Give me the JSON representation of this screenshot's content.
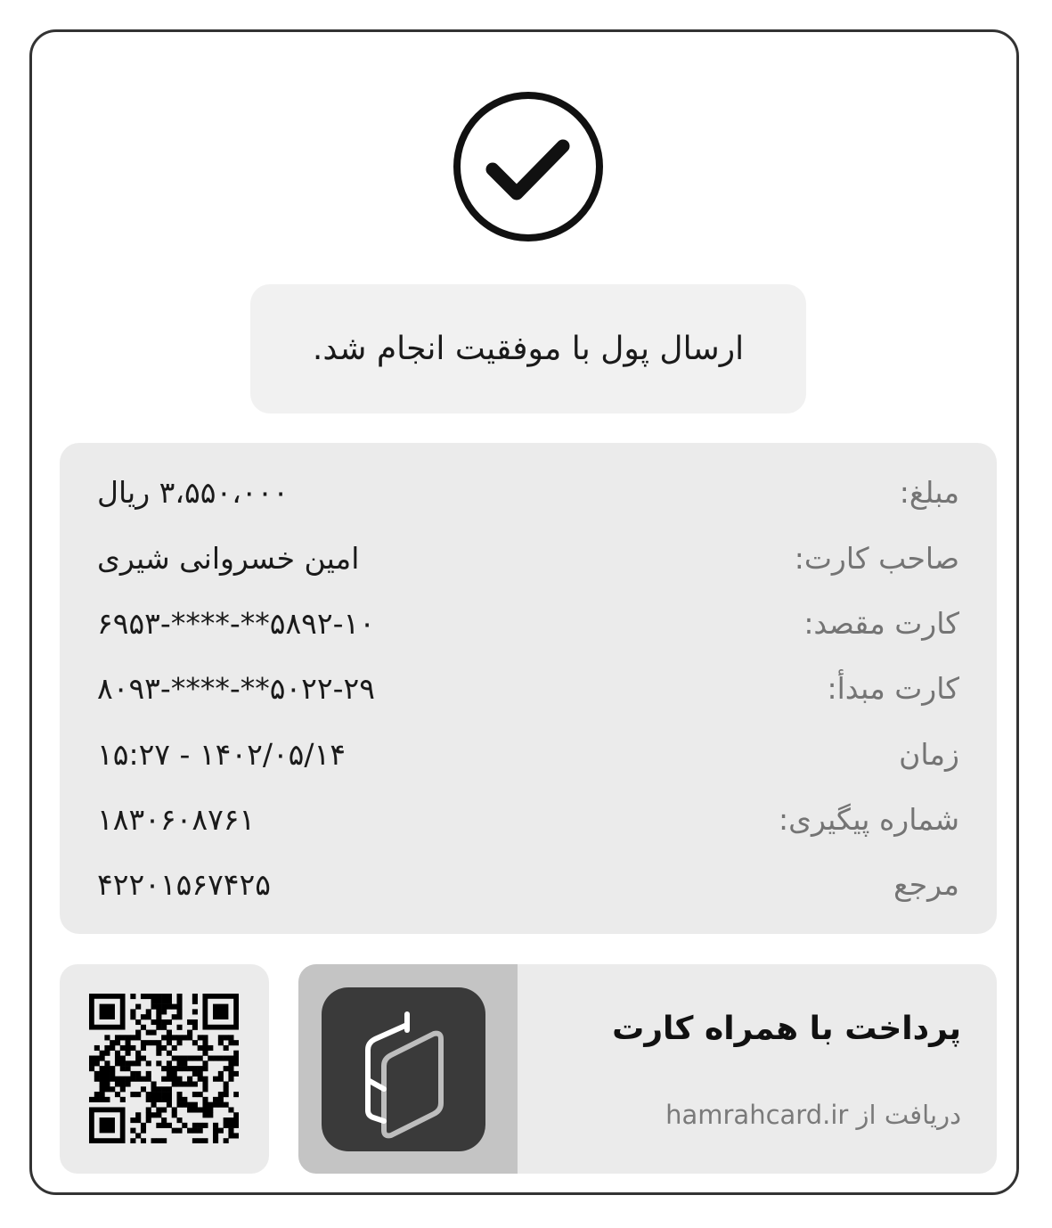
{
  "status": {
    "icon": "check-circle-icon",
    "message": "ارسال پول با موفقیت انجام شد."
  },
  "details": {
    "rows": [
      {
        "label": "مبلغ:",
        "value": "۳،۵۵۰،۰۰۰ ریال"
      },
      {
        "label": "صاحب کارت:",
        "value": "امین خسروانی شیری"
      },
      {
        "label": "کارت مقصد:",
        "value": "۵۸۹۲-۱۰**-****-۶۹۵۳"
      },
      {
        "label": "کارت مبدأ:",
        "value": "۵۰۲۲-۲۹**-****-۸۰۹۳"
      },
      {
        "label": "زمان",
        "value": "۱۴۰۲/۰۵/۱۴ - ۱۵:۲۷"
      },
      {
        "label": "شماره پیگیری:",
        "value": "۱۸۳۰۶۰۸۷۶۱"
      },
      {
        "label": "مرجع",
        "value": "۴۲۲۰۱۵۶۷۴۲۵"
      }
    ]
  },
  "promo": {
    "title": "پرداخت با همراه کارت",
    "subtitle": "دریافت از hamrahcard.ir",
    "app_icon": "hamrahcard-logo-icon",
    "qr_icon": "qr-code-icon"
  },
  "colors": {
    "border": "#333333",
    "panel": "#ebebeb",
    "banner": "#f1f1f1",
    "label": "#747474",
    "text": "#1a1a1a",
    "app_icon_bg": "#3a3a3a"
  }
}
